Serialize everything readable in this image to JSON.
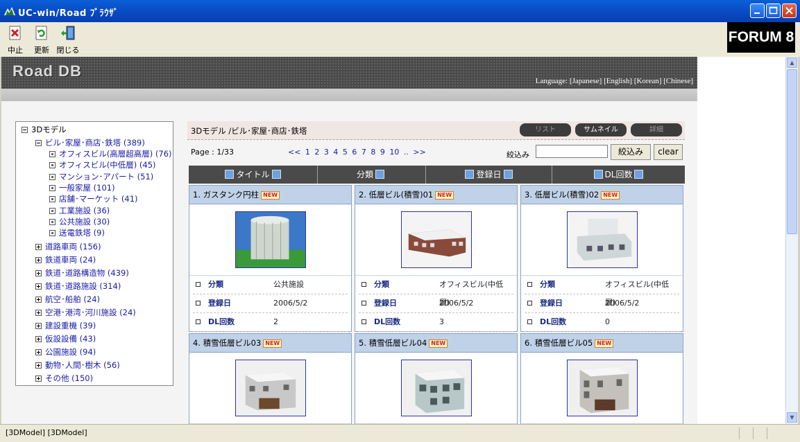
{
  "window": {
    "title": "UC-win/Road ﾌﾞﾗｳｻﾞ"
  },
  "toolbar": {
    "stop_label": "中止",
    "refresh_label": "更新",
    "close_label": "閉じる",
    "brand": "FORUM 8"
  },
  "banner": {
    "logo": "Road DB",
    "language": "Language: [Japanese] [English] [Korean] [Chinese]"
  },
  "tree": {
    "root": "3Dモデル",
    "expanded": "ビル･家屋･商店･鉄塔 (389)",
    "leaves": [
      "オフィスビル(高層超高層) (76)",
      "オフィスビル(中低層) (45)",
      "マンション･アパート (51)",
      "一般家屋 (101)",
      "店舗･マーケット (41)",
      "工業施設 (36)",
      "公共施設 (30)",
      "送電鉄塔 (9)"
    ],
    "categories": [
      "道路車両 (156)",
      "鉄道車両 (24)",
      "鉄道･道路構造物 (439)",
      "鉄道･道路施設 (314)",
      "航空･船舶 (24)",
      "空港･港湾･河川施設 (24)",
      "建設重機 (39)",
      "仮設設備 (43)",
      "公園施設 (94)",
      "動物･人間･樹木 (56)",
      "その他 (150)"
    ]
  },
  "content": {
    "breadcrumb": "3Dモデル /ビル･家屋･商店･鉄塔",
    "view_buttons": [
      "リスト",
      "サムネイル",
      "詳細"
    ],
    "page_info": "Page : 1/33",
    "pager": "<<  1  2  3  4  5  6  7  8  9  10 ..  >>",
    "filter_label": "絞込み",
    "filter_value": "",
    "filter_button": "絞込み",
    "clear_button": "clear",
    "sort_columns": [
      "タイトル",
      "分類",
      "登録日",
      "DL回数"
    ]
  },
  "attr_labels": {
    "category": "分類",
    "date": "登録日",
    "downloads": "DL回数"
  },
  "new_badge": "NEW",
  "cards": [
    {
      "title": "1. ガスタンク円柱",
      "category": "公共施設",
      "date": "2006/5/2",
      "downloads": "2"
    },
    {
      "title": "2. 低層ビル(積雪)01",
      "category": "オフィスビル(中低層)",
      "date": "2006/5/2",
      "downloads": "3"
    },
    {
      "title": "3. 低層ビル(積雪)02",
      "category": "オフィスビル(中低層)",
      "date": "2006/5/2",
      "downloads": "0"
    },
    {
      "title": "4. 積雪低層ビル03",
      "category": "",
      "date": "",
      "downloads": ""
    },
    {
      "title": "5. 積雪低層ビル04",
      "category": "",
      "date": "",
      "downloads": ""
    },
    {
      "title": "6. 積雪低層ビル05",
      "category": "",
      "date": "",
      "downloads": ""
    }
  ],
  "status": {
    "text": "[3DModel] [3DModel]"
  }
}
